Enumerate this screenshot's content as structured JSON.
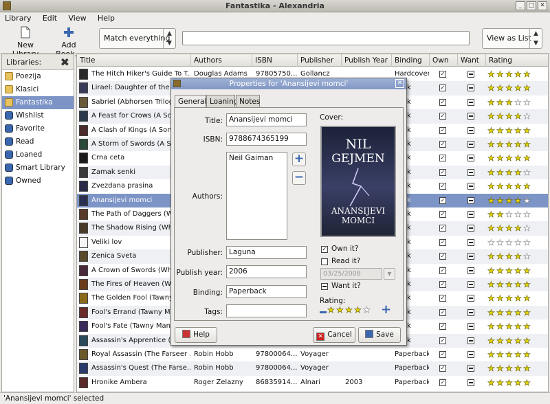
{
  "window": {
    "title": "Fantastika - Alexandria",
    "min": "_",
    "max": "□",
    "close": "✕"
  },
  "menu": [
    "Library",
    "Edit",
    "View",
    "Help"
  ],
  "toolbar": {
    "new_library": "New Library",
    "add_book": "Add Book...",
    "filter_combo": "Match everything",
    "search_value": "",
    "view_combo": "View as List"
  },
  "sidebar": {
    "header": "Libraries:",
    "items": [
      {
        "label": "Poezija",
        "type": "folder"
      },
      {
        "label": "Klasici",
        "type": "folder"
      },
      {
        "label": "Fantastika",
        "type": "folder",
        "selected": true
      },
      {
        "label": "Wishlist",
        "type": "smart"
      },
      {
        "label": "Favorite",
        "type": "smart"
      },
      {
        "label": "Read",
        "type": "smart"
      },
      {
        "label": "Loaned",
        "type": "smart"
      },
      {
        "label": "Smart Library",
        "type": "smart"
      },
      {
        "label": "Owned",
        "type": "smart"
      }
    ]
  },
  "table": {
    "columns": [
      "Title",
      "Authors",
      "ISBN",
      "Publisher",
      "Publish Year",
      "Binding",
      "Own",
      "Want",
      "Rating"
    ],
    "rows": [
      {
        "title": "The Hitch Hiker's Guide To T...",
        "author": "Douglas Adams",
        "isbn": "97805750...",
        "publisher": "Gollancz",
        "year": "",
        "binding": "Hardcover",
        "own": true,
        "rating": 5,
        "cover": "#2a2a2a"
      },
      {
        "title": "Lirael: Daughter of the C",
        "author": "",
        "isbn": "",
        "publisher": "",
        "year": "",
        "binding": "back",
        "own": true,
        "rating": 5,
        "cover": "#3a3a5a"
      },
      {
        "title": "Sabriel (Abhorsen Trilog",
        "author": "",
        "isbn": "",
        "publisher": "",
        "year": "",
        "binding": "back",
        "own": true,
        "rating": 3,
        "cover": "#6a5a3a"
      },
      {
        "title": "A Feast for Crows (A So",
        "author": "",
        "isbn": "",
        "publisher": "",
        "year": "",
        "binding": "back",
        "own": true,
        "rating": 4,
        "cover": "#2a3a4a"
      },
      {
        "title": "A Clash of Kings (A Son",
        "author": "",
        "isbn": "",
        "publisher": "",
        "year": "",
        "binding": "back",
        "own": true,
        "rating": 5,
        "cover": "#4a2a2a"
      },
      {
        "title": "A Storm of Swords (A S",
        "author": "",
        "isbn": "",
        "publisher": "",
        "year": "",
        "binding": "back",
        "own": true,
        "rating": 5,
        "cover": "#2a4a3a"
      },
      {
        "title": "Crna ceta",
        "author": "",
        "isbn": "",
        "publisher": "",
        "year": "",
        "binding": "back",
        "own": true,
        "rating": 5,
        "cover": "#1a1a1a"
      },
      {
        "title": "Zamak senki",
        "author": "",
        "isbn": "",
        "publisher": "",
        "year": "",
        "binding": "back",
        "own": true,
        "rating": 4,
        "cover": "#3a3a3a"
      },
      {
        "title": "Zvezdana prasina",
        "author": "",
        "isbn": "",
        "publisher": "",
        "year": "",
        "binding": "back",
        "own": true,
        "rating": 5,
        "cover": "#2a2a4a"
      },
      {
        "title": "Anansijevi momci",
        "author": "",
        "isbn": "",
        "publisher": "",
        "year": "",
        "binding": "back",
        "own": true,
        "rating": 4,
        "cover": "#2a3050",
        "selected": true
      },
      {
        "title": "The Path of Daggers (Wh",
        "author": "",
        "isbn": "",
        "publisher": "",
        "year": "",
        "binding": "back",
        "own": true,
        "rating": 2,
        "cover": "#5a3a2a"
      },
      {
        "title": "The Shadow Rising (Whe",
        "author": "",
        "isbn": "",
        "publisher": "",
        "year": "",
        "binding": "back",
        "own": true,
        "rating": 4,
        "cover": "#4a3a2a"
      },
      {
        "title": "Veliki lov",
        "author": "",
        "isbn": "",
        "publisher": "",
        "year": "",
        "binding": "back",
        "own": true,
        "rating": 0,
        "cover": "#f4f4f4"
      },
      {
        "title": "Zenica Sveta",
        "author": "",
        "isbn": "",
        "publisher": "",
        "year": "",
        "binding": "back",
        "own": true,
        "rating": 4,
        "cover": "#5a4a2a"
      },
      {
        "title": "A Crown of Swords (Whe",
        "author": "",
        "isbn": "",
        "publisher": "",
        "year": "",
        "binding": "back",
        "own": true,
        "rating": 5,
        "cover": "#4a2a3a"
      },
      {
        "title": "The Fires of Heaven (Wh",
        "author": "",
        "isbn": "",
        "publisher": "",
        "year": "",
        "binding": "back",
        "own": true,
        "rating": 5,
        "cover": "#6a3a1a"
      },
      {
        "title": "The Golden Fool (Tawny",
        "author": "",
        "isbn": "",
        "publisher": "",
        "year": "",
        "binding": "back",
        "own": true,
        "rating": 5,
        "cover": "#8a6a1a"
      },
      {
        "title": "Fool's Errand (Tawny Ma",
        "author": "",
        "isbn": "",
        "publisher": "",
        "year": "",
        "binding": "back",
        "own": true,
        "rating": 5,
        "cover": "#6a2a2a"
      },
      {
        "title": "Fool's Fate (Tawny Man)",
        "author": "",
        "isbn": "",
        "publisher": "",
        "year": "",
        "binding": "back",
        "own": true,
        "rating": 5,
        "cover": "#3a2a5a"
      },
      {
        "title": "Assassin's Apprentice (T",
        "author": "",
        "isbn": "",
        "publisher": "",
        "year": "",
        "binding": "back",
        "own": true,
        "rating": 5,
        "cover": "#2a4a5a"
      },
      {
        "title": "Royal Assassin (The Farseer ...",
        "author": "Robin Hobb",
        "isbn": "97800064...",
        "publisher": "Voyager",
        "year": "",
        "binding": "Paperback",
        "own": true,
        "rating": 5,
        "cover": "#6a5a2a"
      },
      {
        "title": "Assassin's Quest (The Farse...",
        "author": "Robin Hobb",
        "isbn": "97800064...",
        "publisher": "Voyager",
        "year": "",
        "binding": "Paperback",
        "own": true,
        "rating": 5,
        "cover": "#2a3a6a"
      },
      {
        "title": "Hronike Ambera",
        "author": "Roger Zelazny",
        "isbn": "86835914...",
        "publisher": "Alnari",
        "year": "2003",
        "binding": "Paperback",
        "own": true,
        "rating": 5,
        "cover": "#5a2a2a"
      }
    ]
  },
  "status": "'Anansijevi momci' selected",
  "dialog": {
    "title": "Properties for 'Anansijevi momci'",
    "tabs": [
      "General",
      "Loaning",
      "Notes"
    ],
    "labels": {
      "title": "Title:",
      "isbn": "ISBN:",
      "authors": "Authors:",
      "publisher": "Publisher:",
      "publish_year": "Publish year:",
      "binding": "Binding:",
      "tags": "Tags:",
      "cover": "Cover:",
      "rating": "Rating:"
    },
    "values": {
      "title": "Anansijevi momci",
      "isbn": "9788674365199",
      "author": "Neil Gaiman",
      "publisher": "Laguna",
      "publish_year": "2006",
      "binding": "Paperback",
      "tags": ""
    },
    "cover_text": {
      "line1": "NIL",
      "line2": "GEJMEN",
      "line3": "ANANSIJEVI",
      "line4": "MOMCI"
    },
    "own_label": "Own it?",
    "own": true,
    "read_label": "Read it?",
    "read": false,
    "read_date": "03/25/2008",
    "want_label": "Want it?",
    "rating": 4,
    "buttons": {
      "help": "Help",
      "cancel": "Cancel",
      "save": "Save"
    }
  }
}
